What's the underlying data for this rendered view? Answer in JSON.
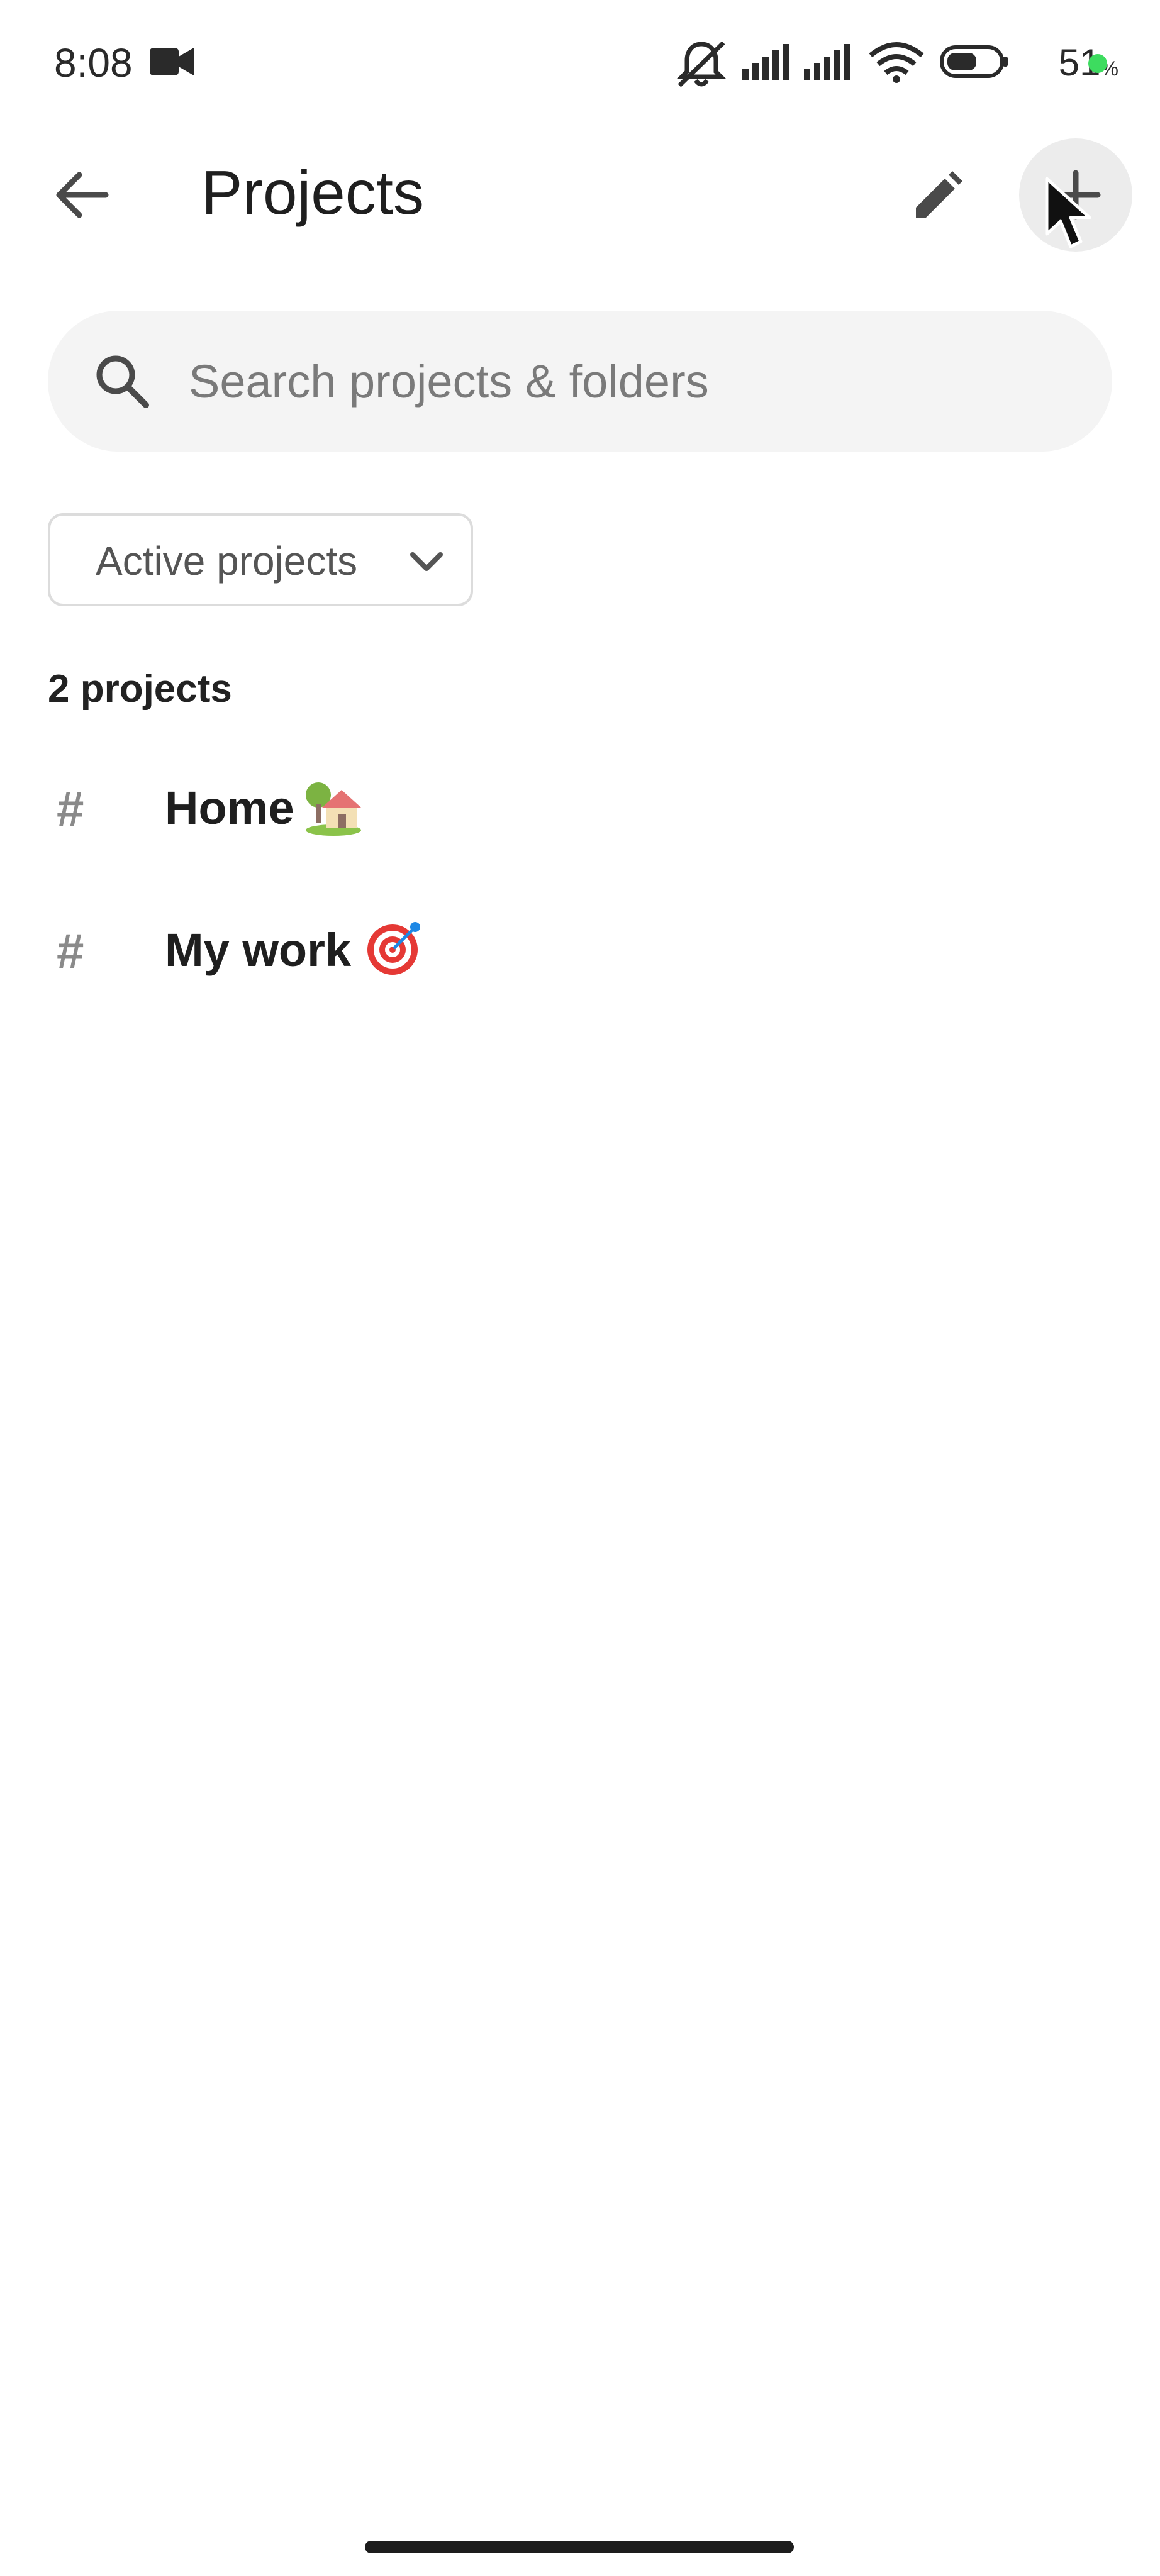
{
  "status_bar": {
    "time": "8:08",
    "battery_percent": "51",
    "battery_unit": "%",
    "battery_dot_color": "#3ddc5f",
    "icons": [
      "video-camera-icon",
      "notifications-muted-icon",
      "signal-icon",
      "signal-icon",
      "wifi-icon",
      "battery-icon"
    ]
  },
  "header": {
    "title": "Projects",
    "back_icon": "arrow-left-icon",
    "edit_icon": "pencil-icon",
    "add_icon": "plus-icon"
  },
  "search": {
    "placeholder": "Search projects & folders",
    "value": "",
    "icon": "search-icon"
  },
  "filter": {
    "label": "Active projects",
    "icon": "chevron-down-icon"
  },
  "projects": {
    "count_label": "2 projects",
    "items": [
      {
        "name": "Home",
        "emoji": "house-with-garden-emoji"
      },
      {
        "name": "My work",
        "emoji": "target-emoji"
      }
    ]
  }
}
